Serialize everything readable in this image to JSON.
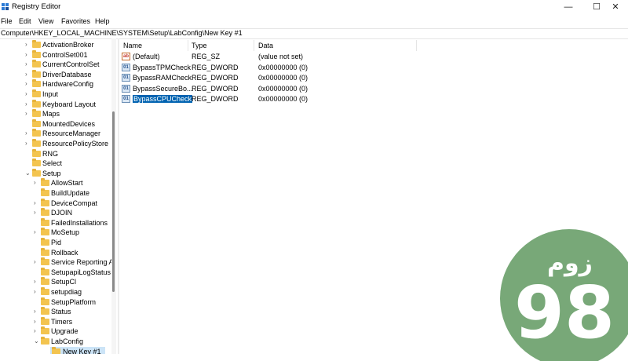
{
  "window": {
    "title": "Registry Editor",
    "minimize": "—",
    "maximize": "☐",
    "close": "✕"
  },
  "menu": [
    "File",
    "Edit",
    "View",
    "Favorites",
    "Help"
  ],
  "address": "Computer\\HKEY_LOCAL_MACHINE\\SYSTEM\\Setup\\LabConfig\\New Key #1",
  "tree": [
    {
      "label": "ActivationBroker",
      "level": 0,
      "expander": ">"
    },
    {
      "label": "ControlSet001",
      "level": 0,
      "expander": ">"
    },
    {
      "label": "CurrentControlSet",
      "level": 0,
      "expander": ">"
    },
    {
      "label": "DriverDatabase",
      "level": 0,
      "expander": ">"
    },
    {
      "label": "HardwareConfig",
      "level": 0,
      "expander": ">"
    },
    {
      "label": "Input",
      "level": 0,
      "expander": ">"
    },
    {
      "label": "Keyboard Layout",
      "level": 0,
      "expander": ">"
    },
    {
      "label": "Maps",
      "level": 0,
      "expander": ">"
    },
    {
      "label": "MountedDevices",
      "level": 0,
      "expander": ""
    },
    {
      "label": "ResourceManager",
      "level": 0,
      "expander": ">"
    },
    {
      "label": "ResourcePolicyStore",
      "level": 0,
      "expander": ">"
    },
    {
      "label": "RNG",
      "level": 0,
      "expander": ""
    },
    {
      "label": "Select",
      "level": 0,
      "expander": ""
    },
    {
      "label": "Setup",
      "level": 0,
      "expander": "v"
    },
    {
      "label": "AllowStart",
      "level": 1,
      "expander": ">"
    },
    {
      "label": "BuildUpdate",
      "level": 1,
      "expander": ""
    },
    {
      "label": "DeviceCompat",
      "level": 1,
      "expander": ">"
    },
    {
      "label": "DJOIN",
      "level": 1,
      "expander": ">"
    },
    {
      "label": "FailedInstallations",
      "level": 1,
      "expander": ""
    },
    {
      "label": "MoSetup",
      "level": 1,
      "expander": ">"
    },
    {
      "label": "Pid",
      "level": 1,
      "expander": ""
    },
    {
      "label": "Rollback",
      "level": 1,
      "expander": ""
    },
    {
      "label": "Service Reporting A",
      "level": 1,
      "expander": ">"
    },
    {
      "label": "SetupapiLogStatus",
      "level": 1,
      "expander": ""
    },
    {
      "label": "SetupCl",
      "level": 1,
      "expander": ">"
    },
    {
      "label": "setupdiag",
      "level": 1,
      "expander": ">"
    },
    {
      "label": "SetupPlatform",
      "level": 1,
      "expander": ""
    },
    {
      "label": "Status",
      "level": 1,
      "expander": ">"
    },
    {
      "label": "Timers",
      "level": 1,
      "expander": ">"
    },
    {
      "label": "Upgrade",
      "level": 1,
      "expander": ">"
    },
    {
      "label": "LabConfig",
      "level": 1,
      "expander": "v"
    },
    {
      "label": "New Key #1",
      "level": 2,
      "expander": "",
      "selected": true
    }
  ],
  "columns": {
    "name": "Name",
    "type": "Type",
    "data": "Data"
  },
  "values": [
    {
      "name": "(Default)",
      "type": "REG_SZ",
      "data": "(value not set)",
      "icon": "ab"
    },
    {
      "name": "BypassTPMCheck",
      "type": "REG_DWORD",
      "data": "0x00000000 (0)",
      "icon": "dword"
    },
    {
      "name": "BypassRAMCheck",
      "type": "REG_DWORD",
      "data": "0x00000000 (0)",
      "icon": "dword"
    },
    {
      "name": "BypassSecureBo...",
      "type": "REG_DWORD",
      "data": "0x00000000 (0)",
      "icon": "dword"
    },
    {
      "name": "BypassCPUCheck",
      "type": "REG_DWORD",
      "data": "0x00000000 (0)",
      "icon": "dword",
      "selected": true
    }
  ],
  "watermark": {
    "text": "زوم",
    "number": "98",
    "color": "#78a878"
  }
}
